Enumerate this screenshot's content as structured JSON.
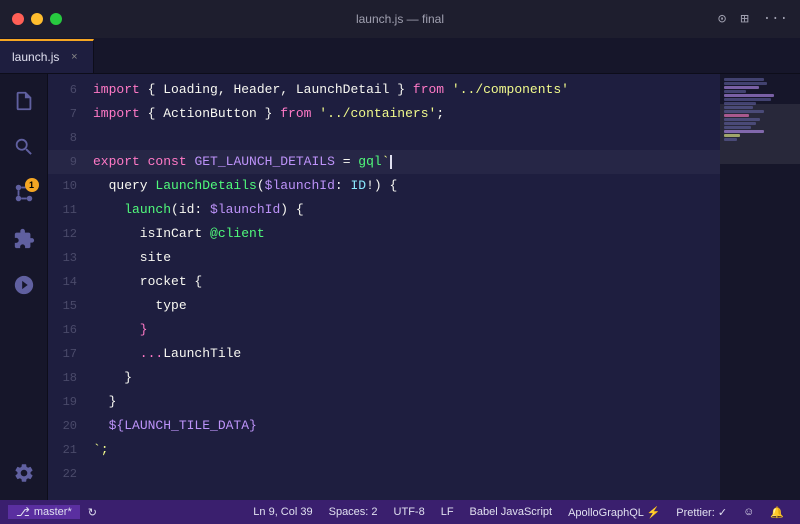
{
  "titlebar": {
    "title": "launch.js — final",
    "dots": [
      "red",
      "yellow",
      "green"
    ]
  },
  "tab": {
    "label": "launch.js",
    "close": "×"
  },
  "code": {
    "lines": [
      {
        "num": 6,
        "tokens": [
          {
            "t": "kw",
            "v": "import"
          },
          {
            "t": "plain",
            "v": " { "
          },
          {
            "t": "plain",
            "v": "Loading"
          },
          {
            "t": "plain",
            "v": ", "
          },
          {
            "t": "plain",
            "v": "Header"
          },
          {
            "t": "plain",
            "v": ", "
          },
          {
            "t": "plain",
            "v": "LaunchDetail"
          },
          {
            "t": "plain",
            "v": " } "
          },
          {
            "t": "kw",
            "v": "from"
          },
          {
            "t": "plain",
            "v": " "
          },
          {
            "t": "str",
            "v": "'../components'"
          }
        ]
      },
      {
        "num": 7,
        "tokens": [
          {
            "t": "kw",
            "v": "import"
          },
          {
            "t": "plain",
            "v": " { "
          },
          {
            "t": "plain",
            "v": "ActionButton"
          },
          {
            "t": "plain",
            "v": " } "
          },
          {
            "t": "kw",
            "v": "from"
          },
          {
            "t": "plain",
            "v": " "
          },
          {
            "t": "str",
            "v": "'../containers'"
          },
          {
            "t": "plain",
            "v": ";"
          }
        ]
      },
      {
        "num": 8,
        "tokens": []
      },
      {
        "num": 9,
        "tokens": [
          {
            "t": "kw",
            "v": "export"
          },
          {
            "t": "plain",
            "v": " "
          },
          {
            "t": "kw",
            "v": "const"
          },
          {
            "t": "plain",
            "v": " "
          },
          {
            "t": "var",
            "v": "GET_LAUNCH_DETAILS"
          },
          {
            "t": "plain",
            "v": " = "
          },
          {
            "t": "fn",
            "v": "gql"
          },
          {
            "t": "str",
            "v": "`"
          }
        ],
        "cursor": true
      },
      {
        "num": 10,
        "tokens": [
          {
            "t": "plain",
            "v": "  query "
          },
          {
            "t": "fn",
            "v": "LaunchDetails"
          },
          {
            "t": "plain",
            "v": "("
          },
          {
            "t": "var",
            "v": "$launchId"
          },
          {
            "t": "plain",
            "v": ": "
          },
          {
            "t": "type",
            "v": "ID"
          },
          {
            "t": "plain",
            "v": "!) {"
          }
        ]
      },
      {
        "num": 11,
        "tokens": [
          {
            "t": "plain",
            "v": "    "
          },
          {
            "t": "fn",
            "v": "launch"
          },
          {
            "t": "plain",
            "v": "(id: "
          },
          {
            "t": "var",
            "v": "$launchId"
          },
          {
            "t": "plain",
            "v": ") {"
          }
        ]
      },
      {
        "num": 12,
        "tokens": [
          {
            "t": "plain",
            "v": "      isInCart "
          },
          {
            "t": "decorator",
            "v": "@client"
          }
        ]
      },
      {
        "num": 13,
        "tokens": [
          {
            "t": "plain",
            "v": "      site"
          }
        ]
      },
      {
        "num": 14,
        "tokens": [
          {
            "t": "plain",
            "v": "      rocket {"
          }
        ]
      },
      {
        "num": 15,
        "tokens": [
          {
            "t": "plain",
            "v": "        type"
          }
        ]
      },
      {
        "num": 16,
        "tokens": [
          {
            "t": "kw",
            "v": "      }"
          }
        ]
      },
      {
        "num": 17,
        "tokens": [
          {
            "t": "spread",
            "v": "      ..."
          },
          {
            "t": "plain",
            "v": "LaunchTile"
          }
        ]
      },
      {
        "num": 18,
        "tokens": [
          {
            "t": "plain",
            "v": "    }"
          }
        ]
      },
      {
        "num": 19,
        "tokens": [
          {
            "t": "plain",
            "v": "  }"
          }
        ]
      },
      {
        "num": 20,
        "tokens": [
          {
            "t": "plain",
            "v": "  "
          },
          {
            "t": "var",
            "v": "${LAUNCH_TILE_DATA}"
          }
        ]
      },
      {
        "num": 21,
        "tokens": [
          {
            "t": "str",
            "v": "`;"
          }
        ]
      },
      {
        "num": 22,
        "tokens": []
      }
    ]
  },
  "statusbar": {
    "branch": "master*",
    "sync_icon": "↻",
    "position": "Ln 9, Col 39",
    "spaces": "Spaces: 2",
    "encoding": "UTF-8",
    "lineending": "LF",
    "language": "Babel JavaScript",
    "schema": "ApolloGraphQL ⚡",
    "formatter": "Prettier: ✓",
    "smiley": "☺",
    "bell": "🔔"
  },
  "minimap": {
    "lines": [
      {
        "w": "60%",
        "color": "#7070b0"
      },
      {
        "w": "50%",
        "color": "#7070b0"
      },
      {
        "w": "70%",
        "color": "#7070b0"
      },
      {
        "w": "30%",
        "color": "#7070b0"
      },
      {
        "w": "80%",
        "color": "#bd93f9"
      },
      {
        "w": "65%",
        "color": "#7070b0"
      },
      {
        "w": "55%",
        "color": "#7070b0"
      },
      {
        "w": "45%",
        "color": "#7070b0"
      },
      {
        "w": "60%",
        "color": "#7070b0"
      },
      {
        "w": "40%",
        "color": "#7070b0"
      },
      {
        "w": "50%",
        "color": "#ff79c6"
      },
      {
        "w": "55%",
        "color": "#7070b0"
      },
      {
        "w": "45%",
        "color": "#7070b0"
      },
      {
        "w": "35%",
        "color": "#7070b0"
      },
      {
        "w": "50%",
        "color": "#bd93f9"
      },
      {
        "w": "25%",
        "color": "#f1fa8c"
      },
      {
        "w": "20%",
        "color": "#7070b0"
      }
    ]
  }
}
